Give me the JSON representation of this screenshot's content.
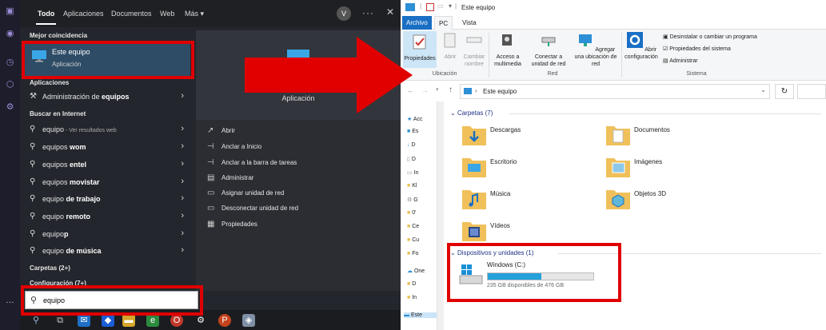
{
  "start_menu": {
    "filters": [
      "Todo",
      "Aplicaciones",
      "Documentos",
      "Web",
      "Más"
    ],
    "avatar_initial": "V",
    "best_match_header": "Mejor coincidencia",
    "best_match": {
      "title": "Este equipo",
      "subtitle": "Aplicación"
    },
    "apps_header": "Aplicaciones",
    "apps": [
      {
        "prefix": "Administración de ",
        "bold": "equipos"
      }
    ],
    "web_header": "Buscar en Internet",
    "web_results": [
      {
        "prefix": "",
        "bold": "",
        "text": "equipo",
        "suffix": " - Ver resultados web"
      },
      {
        "prefix": "equipos ",
        "bold": "wom"
      },
      {
        "prefix": "equipos ",
        "bold": "entel"
      },
      {
        "prefix": "equipos ",
        "bold": "movistar"
      },
      {
        "prefix": "equipo ",
        "bold": "de trabajo"
      },
      {
        "prefix": "equipo ",
        "bold": "remoto"
      },
      {
        "prefix": "equipo",
        "bold": "p"
      },
      {
        "prefix": "equipo ",
        "bold": "de música"
      }
    ],
    "folders_header": "Carpetas (2+)",
    "config_header": "Configuración (7+)",
    "preview_label": "Aplicación",
    "actions": [
      "Abrir",
      "Anclar a Inicio",
      "Anclar a la barra de tareas",
      "Administrar",
      "Asignar unidad de red",
      "Desconectar unidad de red",
      "Propiedades"
    ],
    "search_value": "equipo"
  },
  "explorer": {
    "title": "Este equipo",
    "ribbon_tabs": [
      "Archivo",
      "PC",
      "Vista"
    ],
    "ubicacion_buttons": [
      {
        "label": "Propiedades"
      },
      {
        "label": "Abrir"
      },
      {
        "label": "Cambiar nombre"
      }
    ],
    "red_buttons": [
      {
        "label": "Acceso a multimedia"
      },
      {
        "label": "Conectar a unidad de red"
      },
      {
        "label": "Agregar una ubicación de red"
      }
    ],
    "sistema_button": "Abrir configuración",
    "sistema_items": [
      "Desinstalar o cambiar un programa",
      "Propiedades del sistema",
      "Administrar"
    ],
    "group_labels": [
      "Ubicación",
      "Red",
      "Sistema"
    ],
    "address": "Este equipo",
    "nav_items": [
      "Acc",
      "Es",
      "D",
      "D",
      "In",
      "Kl",
      "G",
      "0'",
      "Ce",
      "Cu",
      "Fo",
      "One",
      "D",
      "In",
      "Este"
    ],
    "folders_header": "Carpetas (7)",
    "folders": [
      "Descargas",
      "Documentos",
      "Escritorio",
      "Imágenes",
      "Música",
      "Objetos 3D",
      "Vídeos"
    ],
    "devices_header": "Dispositivos y unidades (1)",
    "drive": {
      "name": "Windows (C:)",
      "free": "235 GB disponibles de 476 GB",
      "used_fraction": 0.506
    },
    "colors": {
      "accent": "#1a6fc4",
      "drive_bar": "#26a0da",
      "highlight_box": "#e00000"
    }
  }
}
